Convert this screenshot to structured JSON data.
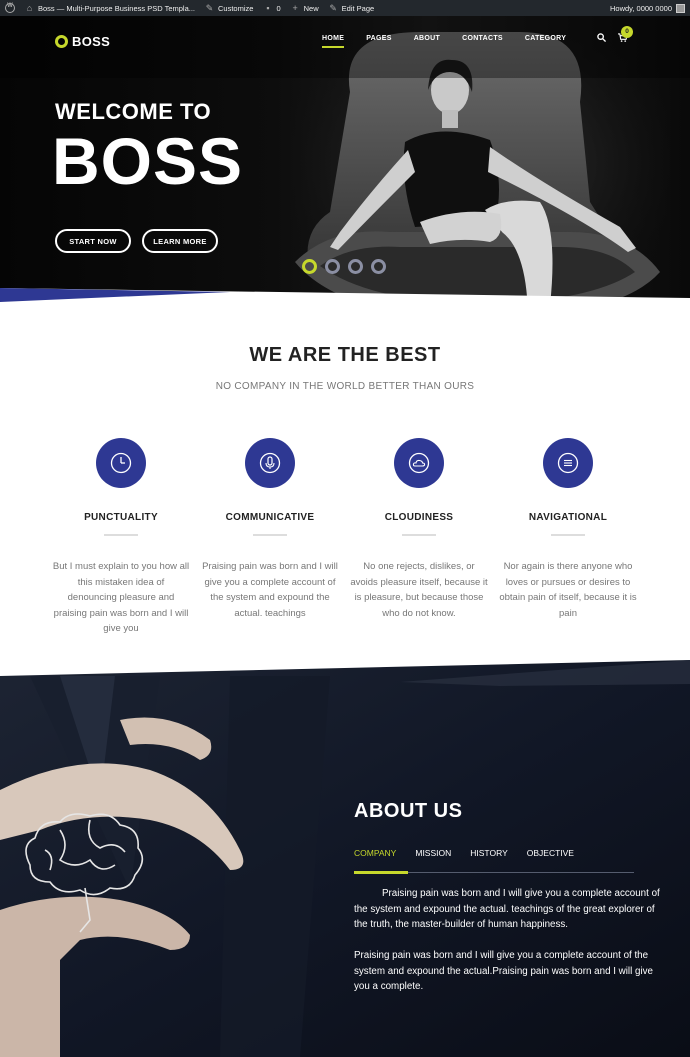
{
  "adminbar": {
    "site_title": "Boss — Multi-Purpose Business PSD Templa...",
    "customize": "Customize",
    "comments_count": "0",
    "new_label": "New",
    "edit_page": "Edit Page",
    "howdy": "Howdy, 0000 0000"
  },
  "header": {
    "logo_text": "BOSS",
    "nav": [
      "HOME",
      "PAGES",
      "ABOUT",
      "CONTACTS",
      "CATEGORY"
    ],
    "cart_count": "0"
  },
  "hero": {
    "subtitle": "WELCOME TO",
    "title": "BOSS",
    "start_label": "START NOW",
    "learn_label": "LEARN MORE",
    "active_slide": 1,
    "slide_count": 4
  },
  "best": {
    "title": "WE ARE THE BEST",
    "subtitle": "NO COMPANY IN THE WORLD BETTER THAN OURS",
    "features": [
      {
        "icon": "clock-icon",
        "title": "PUNCTUALITY",
        "text": "But I must explain to you how all this mistaken idea of denouncing pleasure and praising pain was born and I will give you"
      },
      {
        "icon": "microphone-icon",
        "title": "COMMUNICATIVE",
        "text": "Praising pain was born and I will give you a complete account of the system and expound the actual. teachings"
      },
      {
        "icon": "cloud-icon",
        "title": "CLOUDINESS",
        "text": "No one rejects, dislikes, or avoids pleasure itself, because it is pleasure, but because those who do not know."
      },
      {
        "icon": "menu-icon",
        "title": "NAVIGATIONAL",
        "text": "Nor again is there anyone who loves or pursues or desires to obtain pain of itself, because it is pain"
      }
    ]
  },
  "about": {
    "title": "ABOUT US",
    "tabs": [
      "COMPANY",
      "MISSION",
      "HISTORY",
      "OBJECTIVE"
    ],
    "p1": "Praising pain was born and I will give you a complete account of the system and expound the actual. teachings of the great explorer of the truth, the master-builder of human happiness.",
    "p2": "Praising pain was born and I will give you a complete account of the system and expound the actual.Praising pain was born and I will give you a complete."
  },
  "colors": {
    "accent": "#c6d82c",
    "primary": "#2e3893",
    "dark": "#0b0f1a"
  }
}
